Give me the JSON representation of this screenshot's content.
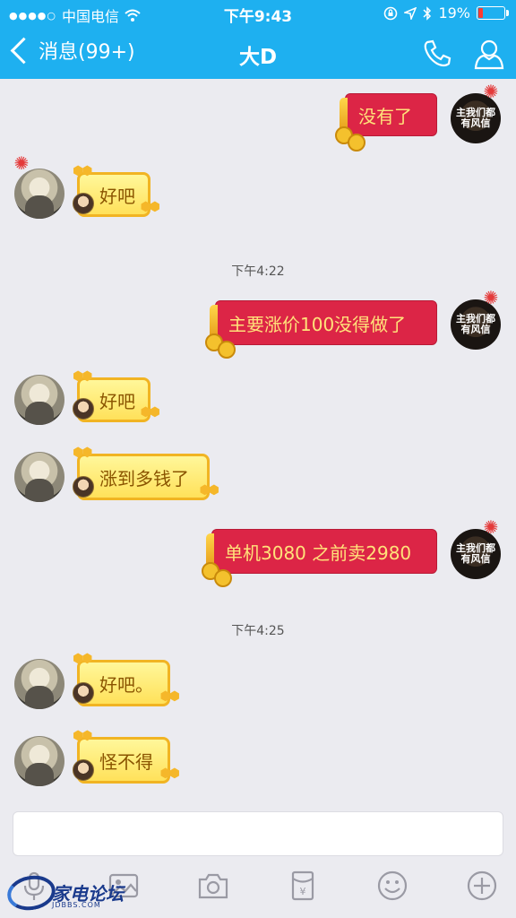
{
  "status": {
    "carrier": "中国电信",
    "time": "下午9:43",
    "battery_percent": "19%",
    "battery_level": 0.19,
    "signal_dots": "●●●●○"
  },
  "nav": {
    "back_label": "消息(99+)",
    "title": "大D",
    "phone_icon": "phone-icon",
    "profile_icon": "profile-icon"
  },
  "colors": {
    "header_blue": "#1eb0f0",
    "red_bubble": "#dc2546",
    "yellow_bubble": "#ffe15a"
  },
  "avatar_caption": "主我们都有风信",
  "messages": [
    {
      "side": "right",
      "text": "没有了"
    },
    {
      "side": "left",
      "text": "好吧"
    },
    {
      "type": "time",
      "text": "下午4:22"
    },
    {
      "side": "right",
      "text": "主要涨价100没得做了"
    },
    {
      "side": "left",
      "text": "好吧"
    },
    {
      "side": "left",
      "text": "涨到多钱了"
    },
    {
      "side": "right",
      "text": "单机3080 之前卖2980"
    },
    {
      "type": "time",
      "text": "下午4:25"
    },
    {
      "side": "left",
      "text": "好吧。"
    },
    {
      "side": "left",
      "text": "怪不得"
    }
  ],
  "toolbar": {
    "icons": [
      "voice-icon",
      "image-icon",
      "camera-icon",
      "red-packet-icon",
      "emoji-icon",
      "plus-icon"
    ]
  },
  "watermark": {
    "text": "家电论坛",
    "sub": "JDBBS.COM"
  }
}
